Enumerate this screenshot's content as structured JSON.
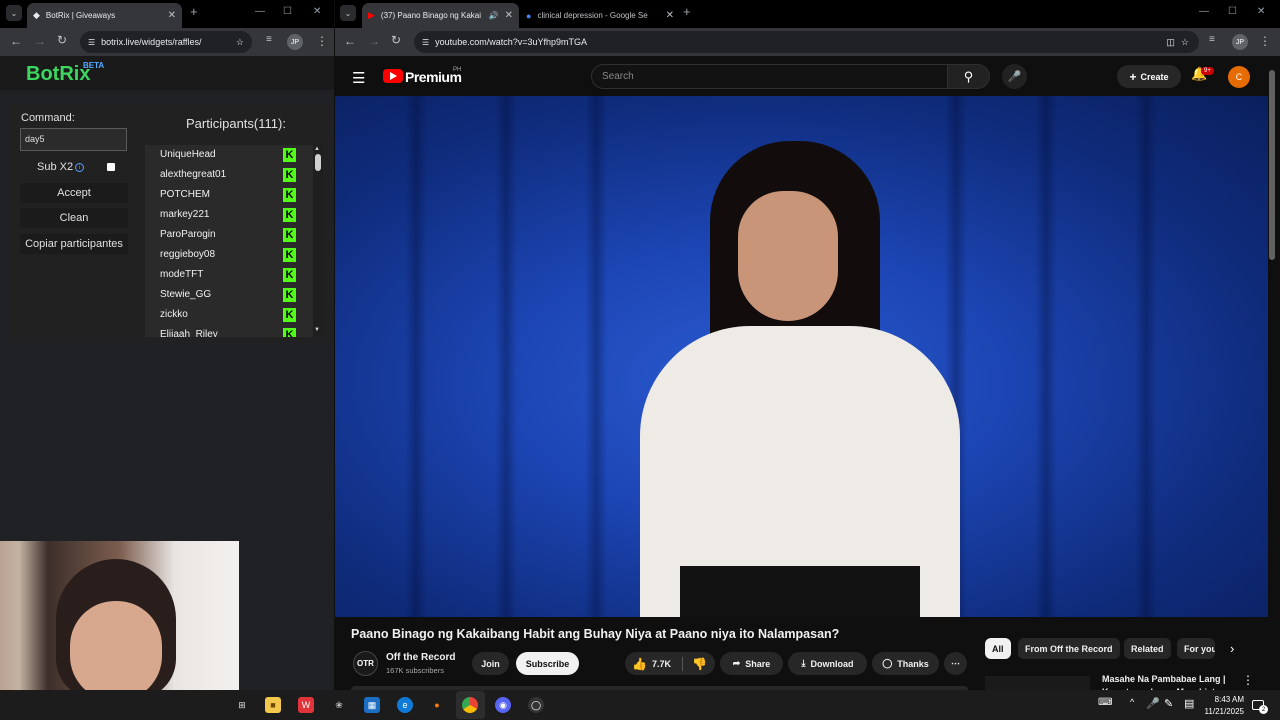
{
  "left_browser": {
    "tab_title": "BotRix | Giveaways",
    "url": "botrix.live/widgets/raffles/",
    "profile": "JP"
  },
  "botrix": {
    "logo": "BotRix",
    "beta": "BETA",
    "command_label": "Command:",
    "command_value": "day5",
    "sub_label": "Sub X2",
    "sub_checked": false,
    "accept_label": "Accept",
    "clean_label": "Clean",
    "copy_label": "Copiar participantes",
    "participants_title": "Participants(111):",
    "participants": [
      "UniqueHead",
      "alexthegreat01",
      "POTCHEM",
      "markey221",
      "ParoParogin",
      "reggieboy08",
      "modeTFT",
      "Stewie_GG",
      "zickko",
      "Elijaah_Riley"
    ],
    "kick_badge": "K",
    "accent_color": "#53fc18"
  },
  "right_browser": {
    "tab1_title": "(37) Paano Binago ng Kakai",
    "tab2_title": "clinical depression - Google Se",
    "url": "youtube.com/watch?v=3uYfhp9mTGA",
    "profile": "JP"
  },
  "youtube": {
    "brand": "Premium",
    "region": "PH",
    "search_placeholder": "Search",
    "create_label": "Create",
    "notif_count": "9+",
    "avatar_letter": "C",
    "video_title": "Paano Binago ng Kakaibang Habit ang Buhay Niya at Paano niya ito Nalampasan?",
    "channel_initials": "OTR",
    "channel_name": "Off the Record",
    "subscribers": "167K subscribers",
    "join_label": "Join",
    "subscribe_label": "Subscribe",
    "likes": "7.7K",
    "share_label": "Share",
    "download_label": "Download",
    "thanks_label": "Thanks",
    "chips": [
      "All",
      "From Off the Record",
      "Related",
      "For you"
    ],
    "rec_title": "Masahe Na Pambabae Lang | Kwento ng Isang Masahista"
  },
  "taskbar": {
    "time": "8:43 AM",
    "date": "11/21/2025",
    "notif": "2"
  }
}
